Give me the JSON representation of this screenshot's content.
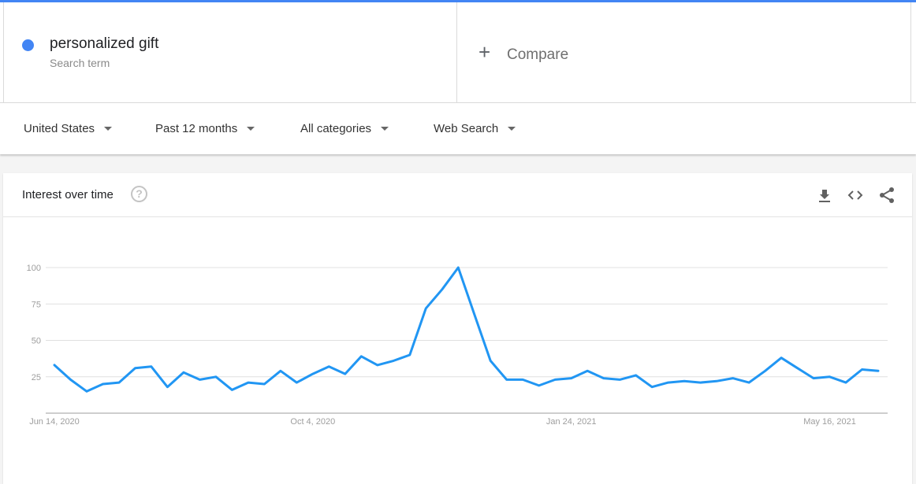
{
  "search_term": {
    "name": "personalized gift",
    "subtitle": "Search term",
    "color": "#4285f4"
  },
  "compare": {
    "icon": "plus-icon",
    "label": "Compare"
  },
  "filters": [
    {
      "label": "United States",
      "icon": "caret-down-icon"
    },
    {
      "label": "Past 12 months",
      "icon": "caret-down-icon"
    },
    {
      "label": "All categories",
      "icon": "caret-down-icon"
    },
    {
      "label": "Web Search",
      "icon": "caret-down-icon"
    }
  ],
  "card": {
    "title": "Interest over time",
    "help_icon": "?",
    "actions": [
      "download-icon",
      "embed-code-icon",
      "share-icon"
    ]
  },
  "chart_data": {
    "type": "line",
    "title": "Interest over time",
    "xlabel": "",
    "ylabel": "",
    "ylim": [
      0,
      100
    ],
    "yticks": [
      25,
      50,
      75,
      100
    ],
    "xtick_labels": [
      {
        "index": 0,
        "label": "Jun 14, 2020"
      },
      {
        "index": 16,
        "label": "Oct 4, 2020"
      },
      {
        "index": 32,
        "label": "Jan 24, 2021"
      },
      {
        "index": 48,
        "label": "May 16, 2021"
      }
    ],
    "grid": true,
    "legend": "none",
    "series": [
      {
        "name": "personalized gift",
        "color": "#2196f3",
        "values": [
          33,
          23,
          15,
          20,
          21,
          31,
          32,
          18,
          28,
          23,
          25,
          16,
          21,
          20,
          29,
          21,
          27,
          32,
          27,
          39,
          33,
          36,
          40,
          72,
          85,
          100,
          68,
          36,
          23,
          23,
          19,
          23,
          24,
          29,
          24,
          23,
          26,
          18,
          21,
          22,
          21,
          22,
          24,
          21,
          29,
          38,
          31,
          24,
          25,
          21,
          30,
          29
        ]
      }
    ]
  }
}
